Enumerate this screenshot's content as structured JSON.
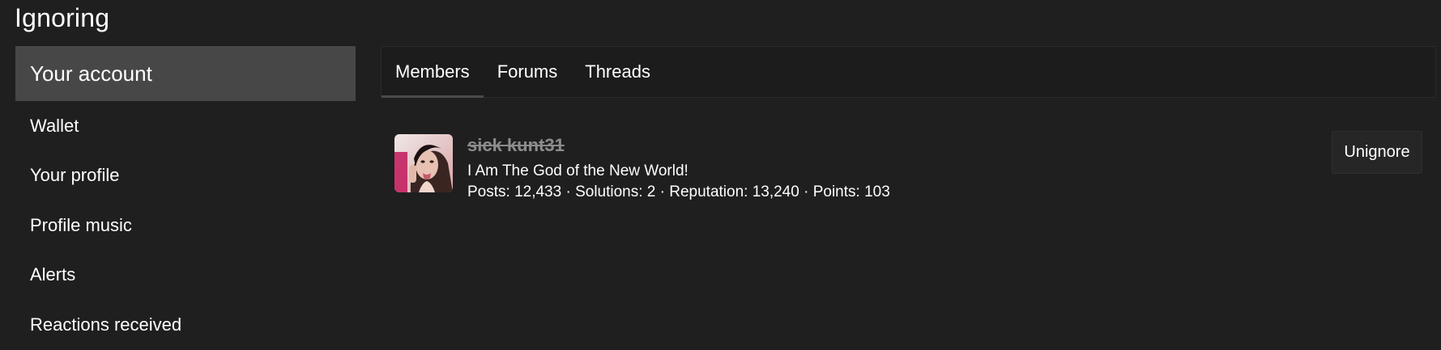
{
  "page": {
    "title": "Ignoring"
  },
  "sidebar": {
    "header": "Your account",
    "items": [
      {
        "label": "Wallet"
      },
      {
        "label": "Your profile"
      },
      {
        "label": "Profile music"
      },
      {
        "label": "Alerts"
      },
      {
        "label": "Reactions received"
      }
    ]
  },
  "tabs": [
    {
      "label": "Members",
      "active": true
    },
    {
      "label": "Forums",
      "active": false
    },
    {
      "label": "Threads",
      "active": false
    }
  ],
  "member": {
    "name": "sick kunt31",
    "title": "I Am The God of the New World!",
    "stats": "Posts: 12,433 · Solutions: 2 · Reputation: 13,240 · Points: 103",
    "avatar_icon": "user-avatar-photo",
    "unignore_label": "Unignore"
  },
  "colors": {
    "background": "#1f1f1f",
    "sidebar_header": "#474747",
    "strikethrough_name": "#8c8c8c"
  }
}
